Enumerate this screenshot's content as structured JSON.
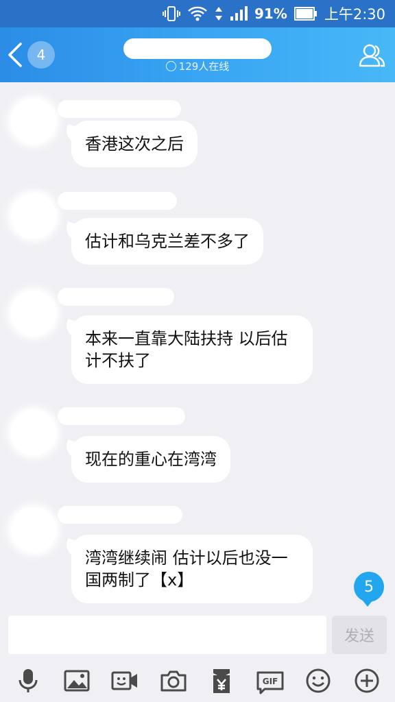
{
  "status_bar": {
    "battery_percent": "91%",
    "time": "上午2:30"
  },
  "header": {
    "back_count": "4",
    "online_text": "129人在线"
  },
  "messages": [
    {
      "text": "香港这次之后"
    },
    {
      "text": "估计和乌克兰差不多了"
    },
    {
      "text": "本来一直靠大陆扶持 以后估计不扶了"
    },
    {
      "text": "现在的重心在湾湾"
    },
    {
      "text": "湾湾继续闹 估计以后也没一国两制了【x】"
    }
  ],
  "unread_badge": "5",
  "input": {
    "value": "",
    "send_label": "发送"
  },
  "toolbar": {
    "items": [
      "microphone-icon",
      "image-icon",
      "video-call-icon",
      "camera-icon",
      "red-packet-icon",
      "gif-icon",
      "emoji-icon",
      "plus-icon"
    ],
    "gif_label": "GIF"
  },
  "colors": {
    "header_start": "#2b8de6",
    "header_end": "#48b8f7",
    "status_bar": "#2a72c7",
    "background": "#efeff4",
    "badge": "#22a6ee",
    "icon": "#4a4a4a"
  }
}
